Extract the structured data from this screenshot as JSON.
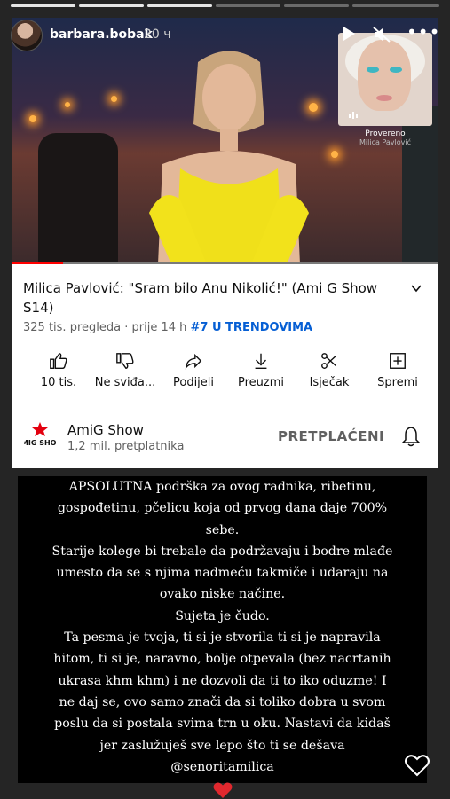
{
  "story": {
    "username": "barbara.bobak",
    "time": "20 ч"
  },
  "video": {
    "overlay_caption": "Provereno",
    "overlay_artist": "Milica Pavlović",
    "title": "Milica Pavlović: \"Sram bilo Anu Nikolić!\" (Ami G Show S14)",
    "views": "325 tis. pregleda",
    "age": "prije 14 h",
    "trending": "#7 U TRENDOVIMA",
    "progress_fraction": 0.12
  },
  "actions": [
    {
      "label": "10 tis.",
      "icon": "thumbs-up-icon"
    },
    {
      "label": "Ne sviđa...",
      "icon": "thumbs-down-icon"
    },
    {
      "label": "Podijeli",
      "icon": "share-icon"
    },
    {
      "label": "Preuzmi",
      "icon": "download-icon"
    },
    {
      "label": "Isječak",
      "icon": "scissors-icon"
    },
    {
      "label": "Spremi",
      "icon": "add-to-playlist-icon"
    }
  ],
  "channel": {
    "name": "AmiG Show",
    "subscribers": "1,2 mil. pretplatnika",
    "subscribe_label": "PRETPLAĆENI",
    "logo_text": "AMIG SHOW"
  },
  "text": {
    "lines": [
      "APSOLUTNA podrška za ovog radnika, ribetinu,",
      "gospođetinu, pčelicu koja od prvog dana daje 700%",
      "sebe.",
      "Starije kolege bi trebale da podržavaju i bodre mlađe",
      "umesto da se s njima nadmeću takmiče i udaraju na",
      "ovako niske načine.",
      "Sujeta je čudo.",
      "Ta pesma je tvoja, ti si je stvorila ti si je napravila",
      "hitom, ti si je, naravno, bolje otpevala (bez nacrtanih",
      "ukrasa khm khm) i ne dozvoli da ti to iko oduzme! I",
      "ne daj se, ovo samo znači da si toliko dobra u svom",
      "poslu da si postala svima trn u oku. Nastavi da kidaš",
      "jer zaslužuješ sve lepo što ti se dešava"
    ],
    "mention": "@senoritamilica"
  },
  "colors": {
    "accent_red": "#ff0000",
    "link_blue": "#065fd4",
    "story_bg": "#252525"
  }
}
